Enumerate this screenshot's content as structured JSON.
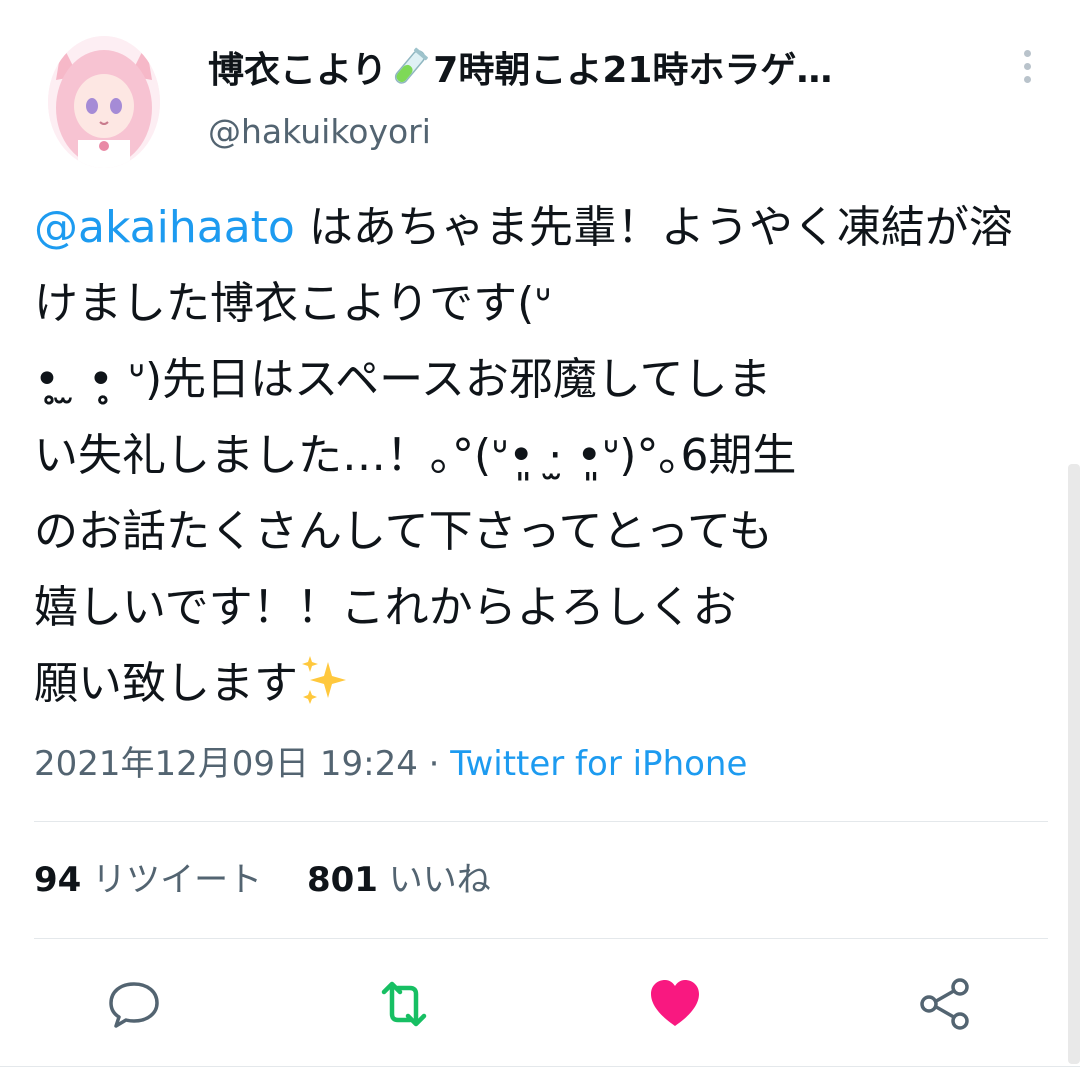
{
  "tweet": {
    "display_name": "博衣こより",
    "display_name_rest": "7時朝こよ21時ホラゲ…",
    "handle": "@hakuikoyori",
    "mention": "@akaihaato",
    "body": " はあちゃま先輩！ようやく凍結が溶けました博衣こよりです(ᐡ\n•̥̥̥ ̫ •̥̥̥ ᐡ)先日はスペースお邪魔してしま\nい失礼しました…！｡°(ᐡ•͈ ·̫ •͈ᐡ)°｡6期生\nのお話たくさんして下さってとっても\n嬉しいです！！これからよろしくお\n願い致します",
    "timestamp": "2021年12月09日 19:24",
    "separator": " · ",
    "source": "Twitter for iPhone"
  },
  "stats": {
    "retweets_count": "94",
    "retweets_label": "リツイート",
    "likes_count": "801",
    "likes_label": "いいね"
  },
  "icons": {
    "reply": "comment-bubble-icon",
    "retweet": "retweet-icon",
    "like": "heart-icon",
    "share": "share-icon",
    "more": "more-vertical-icon",
    "tube": "test-tube-icon",
    "sparkles": "sparkles-icon"
  },
  "colors": {
    "link": "#1d9bf0",
    "secondary_text": "#536471",
    "retweet": "#17bf63",
    "like": "#f91880"
  }
}
